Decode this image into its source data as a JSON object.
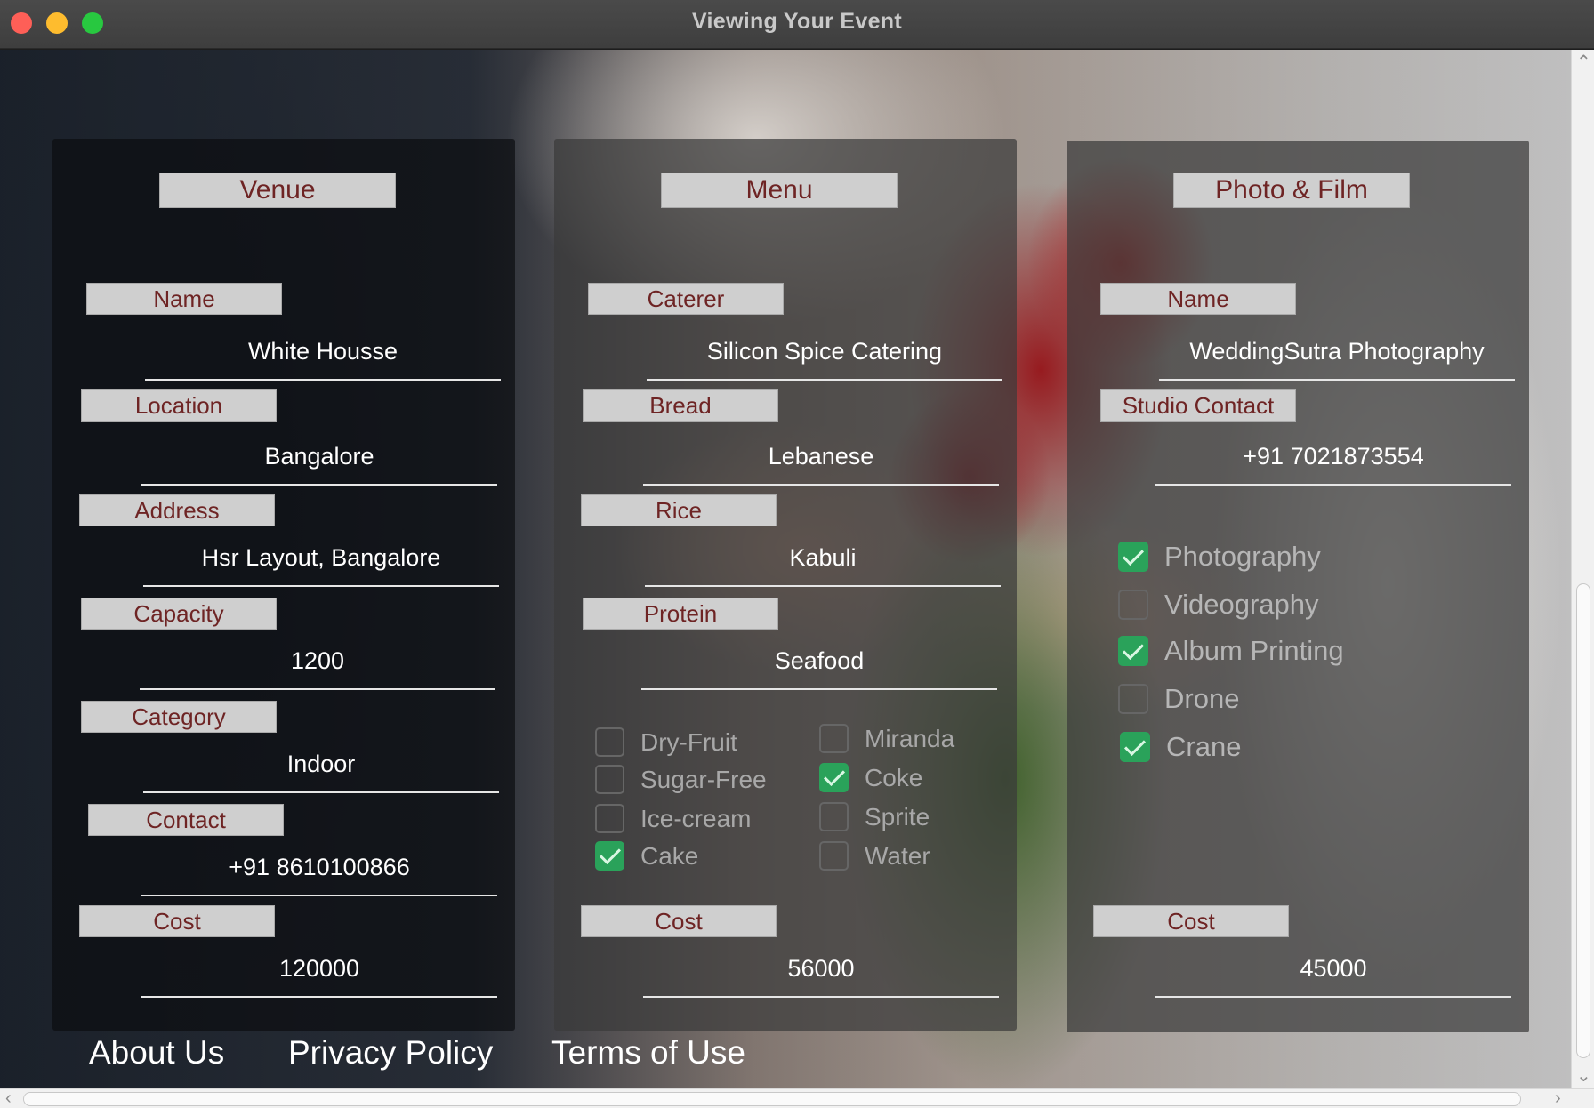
{
  "window": {
    "title": "Viewing Your Event"
  },
  "venue": {
    "header": "Venue",
    "fields": [
      {
        "label": "Name",
        "value": "White Housse"
      },
      {
        "label": "Location",
        "value": "Bangalore"
      },
      {
        "label": "Address",
        "value": "Hsr Layout, Bangalore"
      },
      {
        "label": "Capacity",
        "value": "1200"
      },
      {
        "label": "Category",
        "value": "Indoor"
      },
      {
        "label": "Contact",
        "value": "+91  8610100866"
      },
      {
        "label": "Cost",
        "value": "120000"
      }
    ]
  },
  "menu": {
    "header": "Menu",
    "fields": [
      {
        "label": "Caterer",
        "value": "Silicon Spice Catering"
      },
      {
        "label": "Bread",
        "value": "Lebanese"
      },
      {
        "label": "Rice",
        "value": "Kabuli"
      },
      {
        "label": "Protein",
        "value": "Seafood"
      }
    ],
    "extras_left": [
      {
        "label": "Dry-Fruit",
        "checked": false
      },
      {
        "label": "Sugar-Free",
        "checked": false
      },
      {
        "label": "Ice-cream",
        "checked": false
      },
      {
        "label": "Cake",
        "checked": true
      }
    ],
    "extras_right": [
      {
        "label": "Miranda",
        "checked": false
      },
      {
        "label": "Coke",
        "checked": true
      },
      {
        "label": "Sprite",
        "checked": false
      },
      {
        "label": "Water",
        "checked": false
      }
    ],
    "cost": {
      "label": "Cost",
      "value": "56000"
    }
  },
  "photo": {
    "header": "Photo & Film",
    "fields": [
      {
        "label": "Name",
        "value": "WeddingSutra Photography"
      },
      {
        "label": "Studio Contact",
        "value": "+91  7021873554"
      }
    ],
    "services": [
      {
        "label": "Photography",
        "checked": true
      },
      {
        "label": "Videography",
        "checked": false
      },
      {
        "label": "Album Printing",
        "checked": true
      },
      {
        "label": "Drone",
        "checked": false
      },
      {
        "label": "Crane",
        "checked": true
      }
    ],
    "cost": {
      "label": "Cost",
      "value": "45000"
    }
  },
  "footer": {
    "about": "About Us",
    "privacy": "Privacy Policy",
    "terms": "Terms of Use"
  },
  "colors": {
    "label_text": "#6e2424",
    "check_on": "#2aa25a"
  }
}
